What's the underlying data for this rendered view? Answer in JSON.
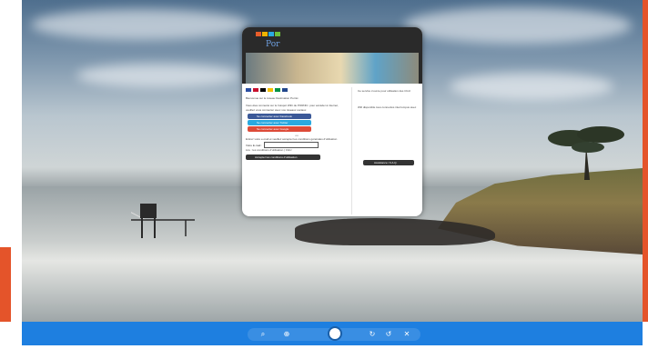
{
  "portal": {
    "welcome_text": "Bienvenue sur le réseau Destination Pornic.",
    "intro_text": "Vous êtes connecté sur le hotspot WiFi de PORNIC. pour accéder à internet, veuillez vous connecter avec vos réseaux sociaux",
    "social_buttons": {
      "facebook": "Se connecter avec Facebook",
      "twitter": "Se connecter avec Twitter",
      "google": "Se connecter avec Google"
    },
    "or_text": "ou",
    "email_intro": "Entrez votre e-mail et veuillez accepter les conditions générales d'utilisation",
    "email_label": "Votre E-mail :",
    "cgu_link": "Lire : les conditions d'utilisation | CGU",
    "accept_button": "Accepter les conditions d'utilisation",
    "right_panel": {
      "info_1": "Ce service s'ouvre pour utilisation des CGU",
      "info_2": "Wifi disponible tous connectés interrompus avec",
      "help_button": "Assistance / F.A.Q."
    }
  },
  "colors": {
    "accent": "#e4542a",
    "taskbar": "#1e7fe0",
    "facebook": "#3b5998",
    "twitter": "#2aa9e0",
    "google": "#dd4b39"
  },
  "taskbar_icons": [
    "search-icon",
    "zoom-icon",
    "start-icon",
    "refresh-icon",
    "settings-icon",
    "close-icon"
  ]
}
